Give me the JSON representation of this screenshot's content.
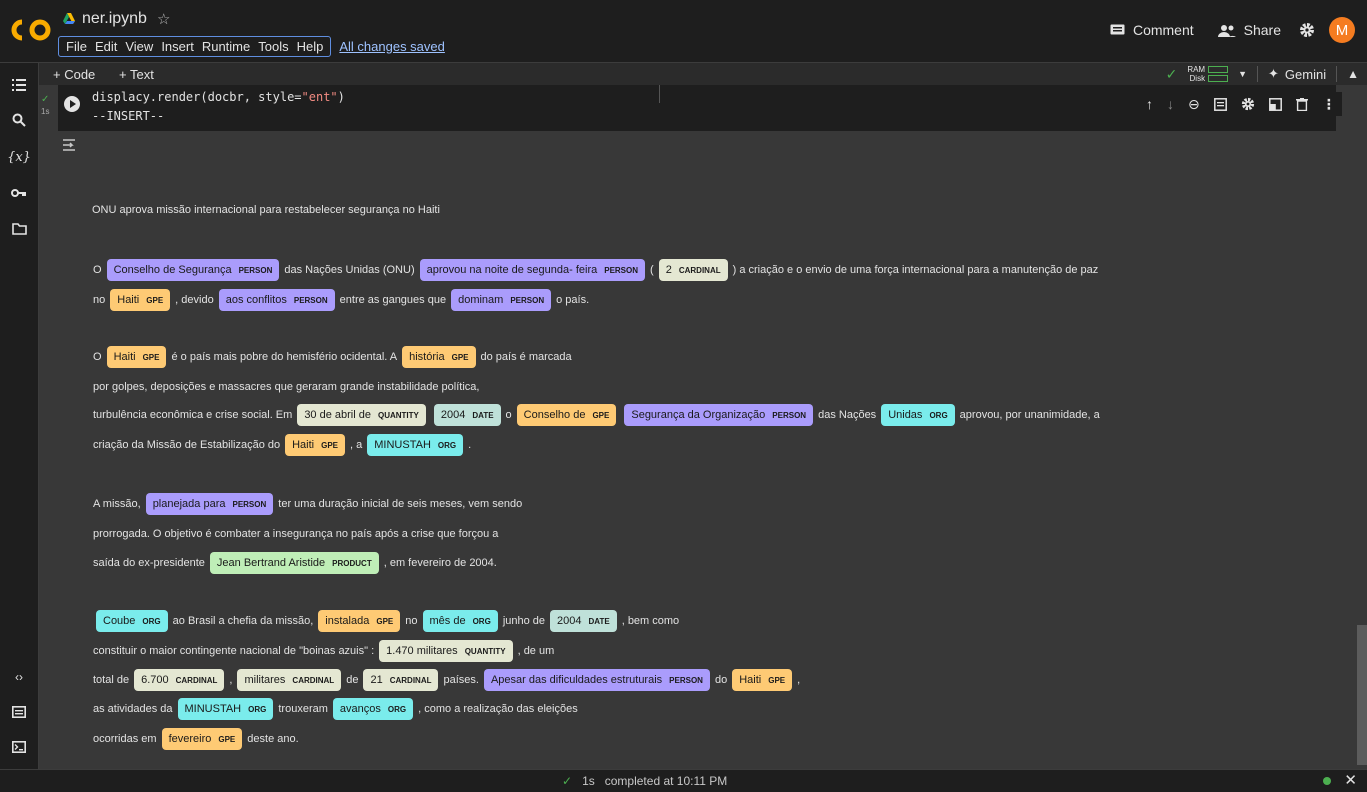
{
  "header": {
    "notebook_title": "ner.ipynb",
    "star": "☆",
    "menu": [
      "File",
      "Edit",
      "View",
      "Insert",
      "Runtime",
      "Tools",
      "Help"
    ],
    "saved_status": "All changes saved",
    "comment_label": "Comment",
    "share_label": "Share",
    "avatar_letter": "M"
  },
  "toolbar": {
    "add_code": "+ Code",
    "add_text": "+ Text",
    "ram_label": "RAM",
    "disk_label": "Disk",
    "gemini_label": "Gemini"
  },
  "cell": {
    "code_line1_prefix": "displacy.render(docbr, style=",
    "code_line1_string": "\"ent\"",
    "code_line1_suffix": ")",
    "code_line2": "--INSERT--",
    "exec_check": "✓",
    "exec_time": "1s"
  },
  "output": {
    "title": "ONU aprova missão internacional para restabelecer segurança no Haiti",
    "lines": [
      [
        {
          "t": "O"
        },
        {
          "e": "Conselho de Segurança",
          "l": "PERSON"
        },
        {
          "t": "das Nações Unidas (ONU)"
        },
        {
          "e": "aprovou na noite de segunda- feira",
          "l": "PERSON"
        },
        {
          "t": "("
        },
        {
          "e": "2",
          "l": "CARDINAL"
        },
        {
          "t": ") a criação e o envio de uma força internacional para a manutenção de paz"
        }
      ],
      [
        {
          "t": "no"
        },
        {
          "e": "Haiti",
          "l": "GPE"
        },
        {
          "t": ", devido"
        },
        {
          "e": "aos conflitos",
          "l": "PERSON"
        },
        {
          "t": "entre as gangues que"
        },
        {
          "e": "dominam",
          "l": "PERSON"
        },
        {
          "t": "o país."
        }
      ],
      [
        {
          "t": "O"
        },
        {
          "e": "Haiti",
          "l": "GPE"
        },
        {
          "t": "é o país mais pobre do hemisfério ocidental. A"
        },
        {
          "e": "história",
          "l": "GPE"
        },
        {
          "t": "do país é marcada"
        }
      ],
      [
        {
          "t": "por golpes, deposições e massacres que geraram grande instabilidade política,"
        }
      ],
      [
        {
          "t": "turbulência econômica e crise social. Em"
        },
        {
          "e": "30 de abril de",
          "l": "QUANTITY"
        },
        {
          "e": "2004",
          "l": "DATE"
        },
        {
          "t": "o"
        },
        {
          "e": "Conselho de",
          "l": "GPE"
        },
        {
          "e": "Segurança da Organização",
          "l": "PERSON"
        },
        {
          "t": "das Nações"
        },
        {
          "e": "Unidas",
          "l": "ORG"
        },
        {
          "t": "aprovou, por unanimidade, a"
        }
      ],
      [
        {
          "t": "criação da Missão de Estabilização do"
        },
        {
          "e": "Haiti",
          "l": "GPE"
        },
        {
          "t": ", a"
        },
        {
          "e": "MINUSTAH",
          "l": "ORG"
        },
        {
          "t": "."
        }
      ],
      [
        {
          "t": "A missão,"
        },
        {
          "e": "planejada para",
          "l": "PERSON"
        },
        {
          "t": "ter uma duração inicial de seis meses, vem sendo"
        }
      ],
      [
        {
          "t": "prorrogada. O objetivo é combater a insegurança no país após a crise que forçou a"
        }
      ],
      [
        {
          "t": "saída do ex-presidente"
        },
        {
          "e": "Jean Bertrand Aristide",
          "l": "PRODUCT"
        },
        {
          "t": ", em fevereiro de 2004."
        }
      ],
      [
        {
          "e": "Coube",
          "l": "ORG"
        },
        {
          "t": "ao Brasil a chefia da missão,"
        },
        {
          "e": "instalada",
          "l": "GPE"
        },
        {
          "t": "no"
        },
        {
          "e": "mês de",
          "l": "ORG"
        },
        {
          "t": "junho de"
        },
        {
          "e": "2004",
          "l": "DATE"
        },
        {
          "t": ", bem como"
        }
      ],
      [
        {
          "t": "constituir o maior contingente nacional de \"boinas azuis\" :"
        },
        {
          "e": "1.470 militares",
          "l": "QUANTITY"
        },
        {
          "t": ", de um"
        }
      ],
      [
        {
          "t": "total de"
        },
        {
          "e": "6.700",
          "l": "CARDINAL"
        },
        {
          "t": ","
        },
        {
          "e": "militares",
          "l": "CARDINAL"
        },
        {
          "t": "de"
        },
        {
          "e": "21",
          "l": "CARDINAL"
        },
        {
          "t": "países."
        },
        {
          "e": "Apesar das dificuldades estruturais",
          "l": "PERSON"
        },
        {
          "t": "do"
        },
        {
          "e": "Haiti",
          "l": "GPE"
        },
        {
          "t": ","
        }
      ],
      [
        {
          "t": "as atividades da"
        },
        {
          "e": "MINUSTAH",
          "l": "ORG"
        },
        {
          "t": "trouxeram"
        },
        {
          "e": "avanços",
          "l": "ORG"
        },
        {
          "t": ", como a realização das eleições"
        }
      ],
      [
        {
          "t": "ocorridas em"
        },
        {
          "e": "fevereiro",
          "l": "GPE"
        },
        {
          "t": "deste ano."
        }
      ]
    ]
  },
  "status": {
    "check": "✓",
    "time": "1s",
    "completed": "completed at 10:11 PM",
    "close": "✕"
  },
  "colors": {
    "accent": "#5f8ee0",
    "PERSON": "#aa9cfc",
    "GPE": "#feca74",
    "ORG": "#7aecec",
    "CARDINAL": "#e4e7d2",
    "QUANTITY": "#e4e7d2",
    "DATE": "#bfe1d9",
    "PRODUCT": "#bfeeb7"
  },
  "icons": [
    "colab-logo-icon",
    "drive-icon",
    "star-icon",
    "comment-icon",
    "share-icon",
    "gear-icon",
    "toc-icon",
    "search-icon",
    "variables-icon",
    "key-icon",
    "folder-icon",
    "code-snippets-icon",
    "command-palette-icon",
    "terminal-icon",
    "run-icon",
    "arrow-up-icon",
    "arrow-down-icon",
    "link-icon",
    "comment-cell-icon",
    "cell-settings-icon",
    "mirror-icon",
    "delete-icon",
    "more-icon",
    "output-icon",
    "close-icon"
  ]
}
